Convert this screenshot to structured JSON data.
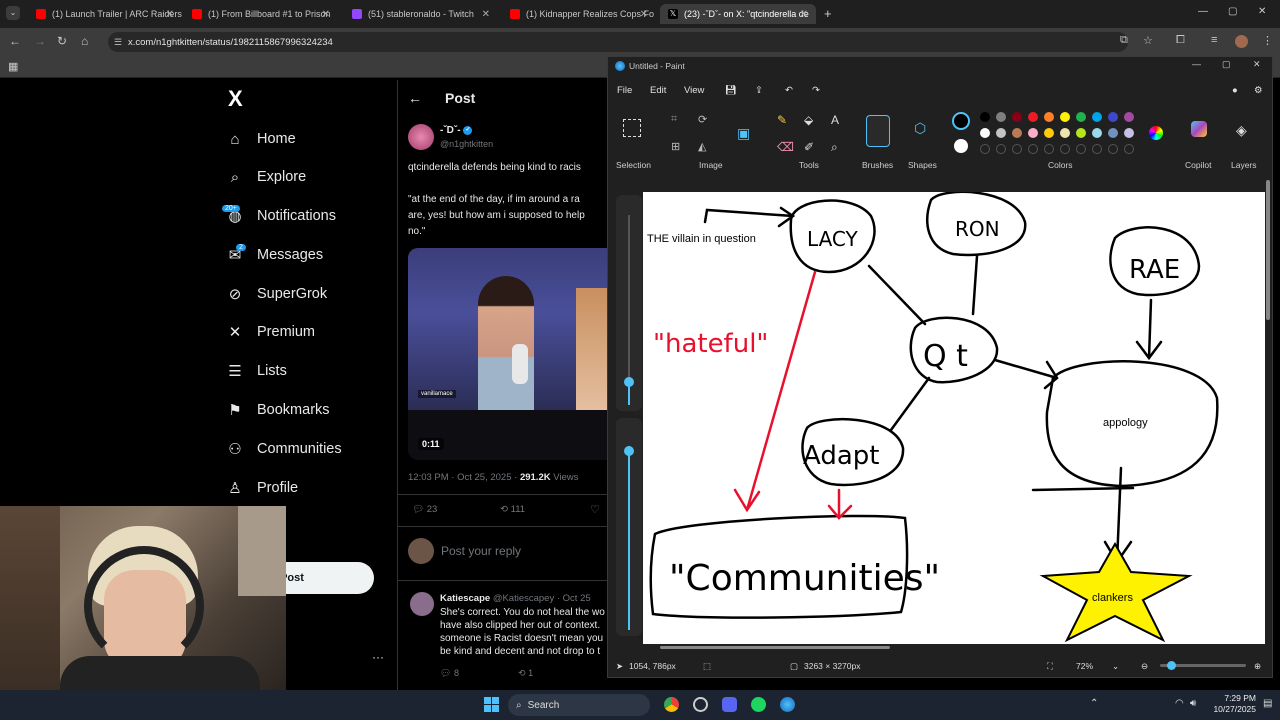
{
  "browser": {
    "tabs": [
      {
        "label": "(1) Launch Trailer | ARC Raiders",
        "favicon_color": "#ff0000"
      },
      {
        "label": "(1) From Billboard #1 to Prison",
        "favicon_color": "#ff0000"
      },
      {
        "label": "(51) stableronaldo - Twitch",
        "favicon_color": "#9146ff"
      },
      {
        "label": "(1) Kidnapper Realizes Cops Fo",
        "favicon_color": "#ff0000"
      },
      {
        "label": "(23) -ˇDˇ- on X: \"qtcinderella de",
        "favicon_color": "#ffffff"
      }
    ],
    "url": "x.com/n1ghtkitten/status/1982115867996324234"
  },
  "x_nav": {
    "logo": "X",
    "items": [
      {
        "label": "Home",
        "icon": "home-icon"
      },
      {
        "label": "Explore",
        "icon": "search-icon"
      },
      {
        "label": "Notifications",
        "icon": "bell-icon",
        "badge": "20+"
      },
      {
        "label": "Messages",
        "icon": "mail-icon",
        "badge": "2"
      },
      {
        "label": "SuperGrok",
        "icon": "grok-icon"
      },
      {
        "label": "Premium",
        "icon": "x-icon"
      },
      {
        "label": "Lists",
        "icon": "list-icon"
      },
      {
        "label": "Bookmarks",
        "icon": "bookmark-icon"
      },
      {
        "label": "Communities",
        "icon": "people-icon"
      },
      {
        "label": "Profile",
        "icon": "person-icon"
      }
    ],
    "post_button": "Post"
  },
  "post": {
    "header": "Post",
    "author_name": "-ˇDˇ-",
    "author_handle": "@n1ghtkitten",
    "text_line1": "qtcinderella defends being kind to racis",
    "text_line2": "\"at the end of the day, if im around a ra",
    "text_line3": "are, yes! but how am i supposed to help",
    "text_line4": "no.\"",
    "video_time": "0:11",
    "video_watermark": "vanillamace",
    "timestamp": "12:03 PM · Oct 25, 2025 · ",
    "views_count": "291.2K",
    "views_label": " Views",
    "replies": "23",
    "reposts": "111",
    "reply_placeholder": "Post your reply"
  },
  "reply": {
    "name": "Katiescape",
    "handle": "@Katiescapey · Oct 25",
    "line1": "She's correct. You do not heal the wo",
    "line2": "have also clipped her out of context.",
    "line3": "someone is Racist doesn't mean you",
    "line4": "be kind and decent and not drop to t",
    "replies": "8",
    "reposts": "1"
  },
  "paint": {
    "title": "Untitled - Paint",
    "menu": [
      "File",
      "Edit",
      "View"
    ],
    "groups": [
      "Selection",
      "Image",
      "Tools",
      "Brushes",
      "Shapes",
      "Colors",
      "Copilot",
      "Layers"
    ],
    "palette_row1": [
      "#000000",
      "#7f7f7f",
      "#880015",
      "#ed1c24",
      "#ff7f27",
      "#fff200",
      "#22b14c",
      "#00a2e8",
      "#3f48cc",
      "#a349a4"
    ],
    "palette_row2": [
      "#ffffff",
      "#c3c3c3",
      "#b97a57",
      "#ffaec9",
      "#ffc90e",
      "#efe4b0",
      "#b5e61d",
      "#99d9ea",
      "#7092be",
      "#c8bfe7"
    ],
    "cursor_pos": "1054, 786px",
    "canvas_size": "3263 × 3270px",
    "zoom": "72%",
    "drawing": {
      "caption": "THE villain in question",
      "lacy": "LACY",
      "ron": "RON",
      "rae": "RAE",
      "qt": "Q t",
      "adapt": "Adapt",
      "hateful": "\"hateful\"",
      "communities": "\"Communities\"",
      "appology": "appology",
      "clankers": "clankers"
    }
  },
  "taskbar": {
    "search": "Search",
    "time": "7:29 PM",
    "date": "10/27/2025"
  }
}
